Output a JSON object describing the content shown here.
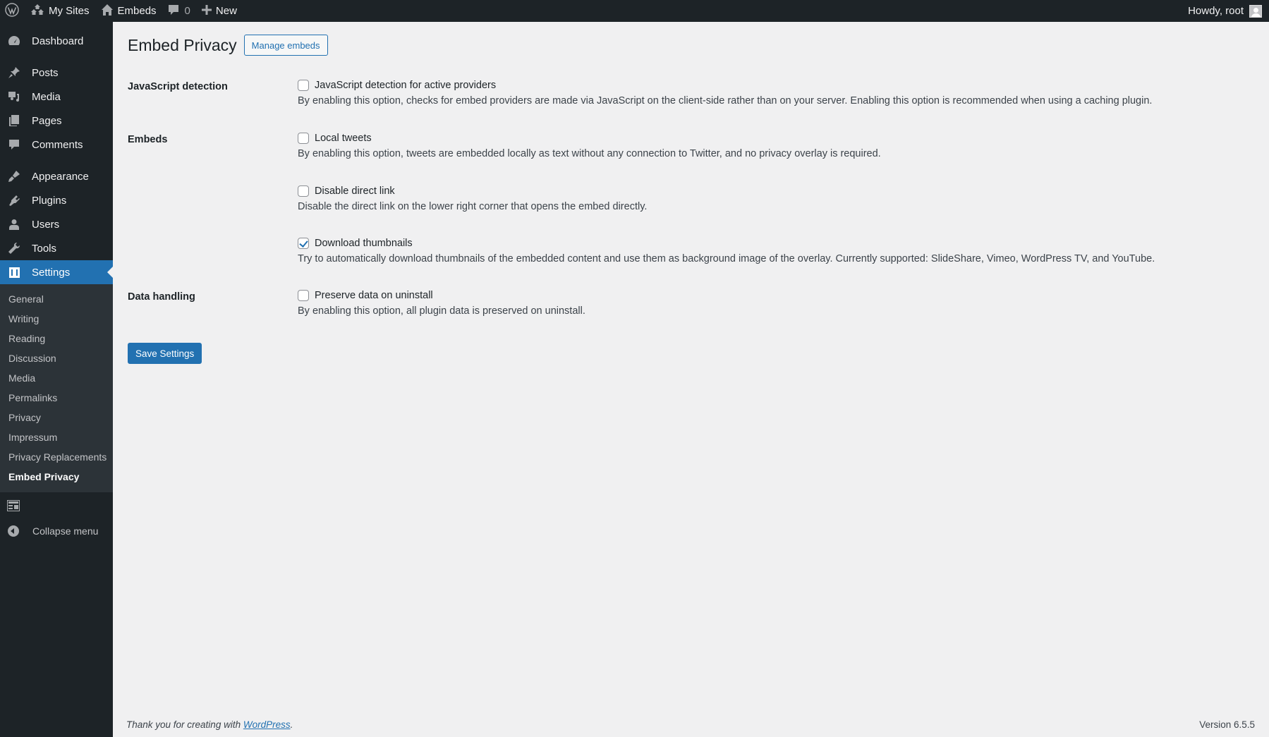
{
  "adminbar": {
    "logo_icon": "wordpress-logo-icon",
    "my_sites": "My Sites",
    "site_name": "Embeds",
    "comments_count": "0",
    "new_label": "New",
    "greeting": "Howdy, root"
  },
  "sidebar": {
    "items": [
      {
        "label": "Dashboard",
        "icon": "dashboard-icon"
      },
      {
        "label": "Posts",
        "icon": "pin-icon"
      },
      {
        "label": "Media",
        "icon": "media-icon"
      },
      {
        "label": "Pages",
        "icon": "pages-icon"
      },
      {
        "label": "Comments",
        "icon": "comment-icon"
      },
      {
        "label": "Appearance",
        "icon": "paintbrush-icon"
      },
      {
        "label": "Plugins",
        "icon": "plugin-icon"
      },
      {
        "label": "Users",
        "icon": "user-icon"
      },
      {
        "label": "Tools",
        "icon": "wrench-icon"
      },
      {
        "label": "Settings",
        "icon": "settings-icon",
        "active": true
      }
    ],
    "submenu": [
      "General",
      "Writing",
      "Reading",
      "Discussion",
      "Media",
      "Permalinks",
      "Privacy",
      "Impressum",
      "Privacy Replacements",
      "Embed Privacy"
    ],
    "current_submenu": "Embed Privacy",
    "collapse_label": "Collapse menu"
  },
  "page": {
    "title": "Embed Privacy",
    "manage_button": "Manage embeds",
    "sections": [
      {
        "heading": "JavaScript detection"
      },
      {
        "heading": "Embeds"
      },
      {
        "heading": "Data handling"
      }
    ],
    "options": [
      {
        "label": "JavaScript detection for active providers",
        "checked": false,
        "description": "By enabling this option, checks for embed providers are made via JavaScript on the client-side rather than on your server. Enabling this option is recommended when using a caching plugin."
      },
      {
        "label": "Local tweets",
        "checked": false,
        "description": "By enabling this option, tweets are embedded locally as text without any connection to Twitter, and no privacy overlay is required."
      },
      {
        "label": "Disable direct link",
        "checked": false,
        "description": "Disable the direct link on the lower right corner that opens the embed directly."
      },
      {
        "label": "Download thumbnails",
        "checked": true,
        "description": "Try to automatically download thumbnails of the embedded content and use them as background image of the overlay. Currently supported: SlideShare, Vimeo, WordPress TV, and YouTube."
      },
      {
        "label": "Preserve data on uninstall",
        "checked": false,
        "description": "By enabling this option, all plugin data is preserved on uninstall."
      }
    ],
    "save_button": "Save Settings"
  },
  "footer": {
    "thanks_prefix": "Thank you for creating with ",
    "thanks_link": "WordPress",
    "thanks_suffix": ".",
    "version": "Version 6.5.5"
  },
  "colors": {
    "accent": "#2271b1",
    "adminbar_bg": "#1d2327",
    "submenu_bg": "#2c3338",
    "page_bg": "#f0f0f1"
  }
}
